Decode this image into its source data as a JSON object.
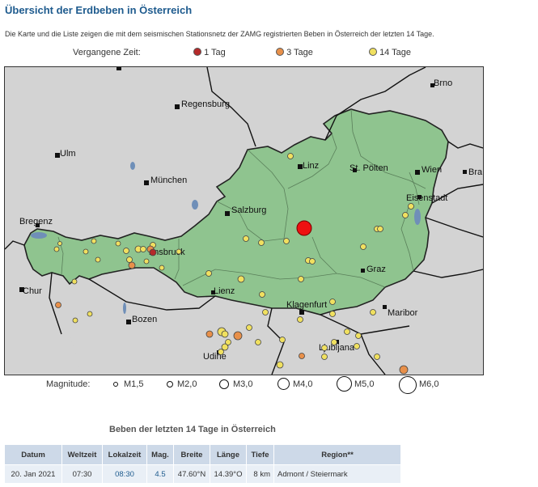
{
  "page": {
    "title": "Übersicht der Erdbeben in Österreich",
    "intro": "Die Karte und die Liste zeigen die mit dem seismischen Stationsnetz der ZAMG registrierten Beben in Österreich der letzten 14 Tage."
  },
  "time_legend": {
    "label": "Vergangene Zeit:",
    "items": [
      {
        "label": "1 Tag",
        "color": "#b52a2a"
      },
      {
        "label": "3 Tage",
        "color": "#e8904a"
      },
      {
        "label": "14 Tage",
        "color": "#f0e060"
      }
    ]
  },
  "map": {
    "colors": {
      "austria": "#8fc48f",
      "neighbours": "#d3d3d3",
      "lake": "#6f8fb8",
      "city": "#111111"
    },
    "cities": [
      {
        "name": "Brno"
      },
      {
        "name": "Regensburg"
      },
      {
        "name": "Ulm"
      },
      {
        "name": "Linz"
      },
      {
        "name": "St. Pölten"
      },
      {
        "name": "Wien"
      },
      {
        "name": "Bra"
      },
      {
        "name": "München"
      },
      {
        "name": "Eisenstadt"
      },
      {
        "name": "Salzburg"
      },
      {
        "name": "Bregenz"
      },
      {
        "name": "nnsbruck"
      },
      {
        "name": "Graz"
      },
      {
        "name": "Chur"
      },
      {
        "name": "Lienz"
      },
      {
        "name": "Klagenfurt"
      },
      {
        "name": "Maribor"
      },
      {
        "name": "Bozen"
      },
      {
        "name": "Ljubljana"
      },
      {
        "name": "Udine"
      }
    ],
    "latest_event_color": "#ee1111"
  },
  "magnitude_legend": {
    "label": "Magnitude:",
    "items": [
      "M1,5",
      "M2,0",
      "M3,0",
      "M4,0",
      "M5,0",
      "M6,0"
    ]
  },
  "list": {
    "title": "Beben der letzten 14 Tage in Österreich",
    "columns": [
      "Datum",
      "Weltzeit",
      "Lokalzeit",
      "Mag.",
      "Breite",
      "Länge",
      "Tiefe",
      "Region**"
    ],
    "rows": [
      {
        "datum": "20. Jan 2021",
        "weltzeit": "07:30",
        "lokalzeit": "08:30",
        "mag": "4.5",
        "breite": "47.60°N",
        "laenge": "14.39°O",
        "tiefe": "8 km",
        "region": "Admont / Steiermark"
      }
    ]
  }
}
